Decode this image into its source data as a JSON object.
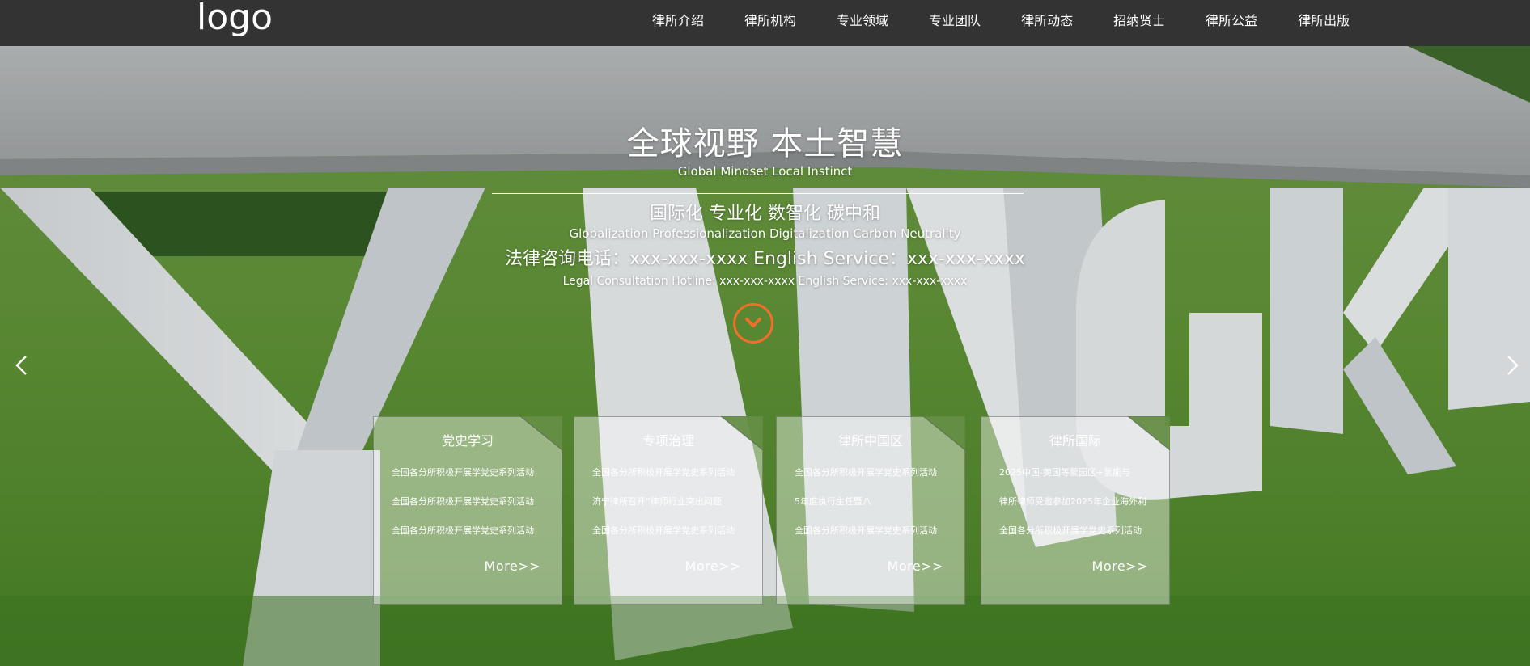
{
  "header": {
    "logo": "logo",
    "nav": [
      "律所介绍",
      "律所机构",
      "专业领域",
      "专业团队",
      "律所动态",
      "招纳贤士",
      "律所公益",
      "律所出版"
    ]
  },
  "hero": {
    "title": "全球视野 本土智慧",
    "title_en": "Global Mindset   Local Instinct",
    "subtitle": "国际化 专业化 数智化 碳中和",
    "subtitle_en": "Globalization Professionalization Digitalization Carbon Neutrality",
    "hotline": "法律咨询电话：xxx-xxx-xxxx English Service：xxx-xxx-xxxx",
    "hotline_en": "Legal Consultation Hotline: xxx-xxx-xxxx English Service: xxx-xxx-xxxx",
    "down_icon": "chevron-down-icon",
    "accent_color": "#f0702a"
  },
  "cards": [
    {
      "title": "党史学习",
      "items": [
        "全国各分所积极开展学党史系列活动",
        "全国各分所积极开展学党史系列活动",
        "全国各分所积极开展学党史系列活动"
      ],
      "more": "More>>"
    },
    {
      "title": "专项治理",
      "items": [
        "全国各分所积极开展学党史系列活动",
        "济宁律所召开“律师行业突出问题",
        "全国各分所积极开展学党史系列活动"
      ],
      "more": "More>>"
    },
    {
      "title": "律所中国区",
      "items": [
        "全国各分所积极开展学党史系列活动",
        "5年度执行主任暨八",
        "全国各分所积极开展学党史系列活动"
      ],
      "more": "More>>"
    },
    {
      "title": "律所国际",
      "items": [
        "2025中国-美国等蒙园区+氢能与",
        "律所律师受邀参加2025年企业海外利",
        "全国各分所积极开展学党史系列活动"
      ],
      "more": "More>>"
    }
  ]
}
